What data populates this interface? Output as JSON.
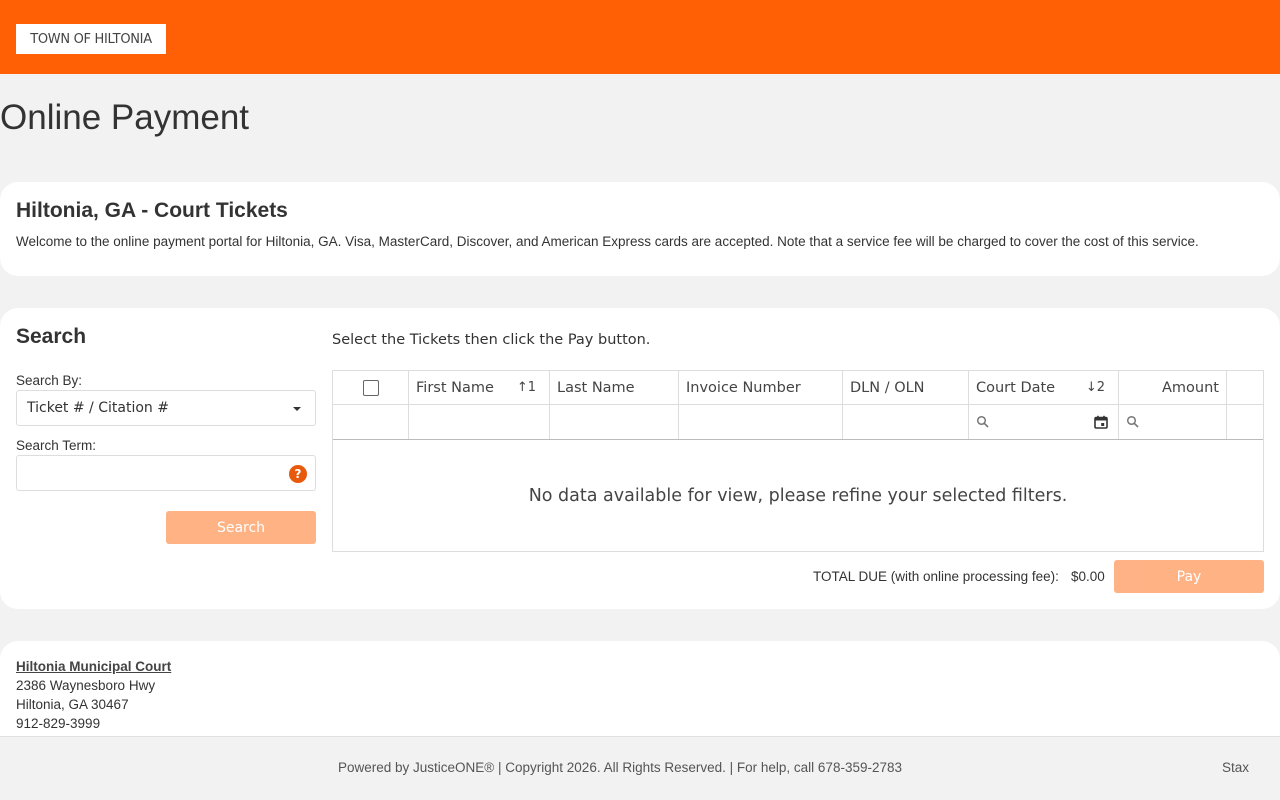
{
  "header": {
    "logo_text": "TOWN OF HILTONIA",
    "brand_color": "#ff6005"
  },
  "page": {
    "title": "Online Payment"
  },
  "intro": {
    "heading": "Hiltonia, GA - Court Tickets",
    "text": "Welcome to the online payment portal for Hiltonia, GA. Visa, MasterCard, Discover, and American Express cards are accepted. Note that a service fee will be charged to cover the cost of this service."
  },
  "search": {
    "title": "Search",
    "search_by_label": "Search By:",
    "search_by_value": "Ticket # / Citation #",
    "search_term_label": "Search Term:",
    "search_term_value": "",
    "help_glyph": "?",
    "button_label": "Search"
  },
  "results": {
    "instructions": "Select the Tickets then click the Pay button.",
    "columns": [
      "First Name",
      "Last Name",
      "Invoice Number",
      "DLN / OLN",
      "Court Date",
      "Amount"
    ],
    "sort_first_name": "1",
    "sort_court_date": "2",
    "no_data": "No data available for view, please refine your selected filters.",
    "rows": []
  },
  "payment": {
    "total_label": "TOTAL DUE (with online processing fee):",
    "total_value": "$0.00",
    "pay_label": "Pay"
  },
  "address": {
    "court_name": "Hiltonia Municipal Court",
    "street": "2386 Waynesboro Hwy",
    "city": "Hiltonia, GA 30467",
    "phone": "912-829-3999"
  },
  "footer": {
    "copyright": "Powered by JusticeONE® | Copyright 2026. All Rights Reserved. | For help, call 678-359-2783",
    "stax": "Stax"
  }
}
